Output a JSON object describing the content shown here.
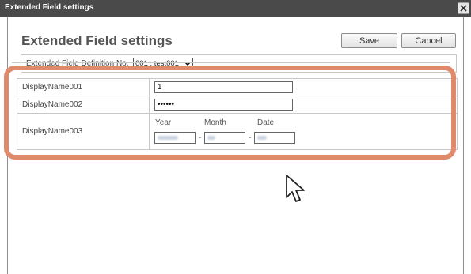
{
  "window": {
    "titlebar_text": "Extended Field settings",
    "page_title": "Extended Field settings"
  },
  "toolbar": {
    "save_label": "Save",
    "cancel_label": "Cancel"
  },
  "definition": {
    "label": "Extended Field Definition No.",
    "selected": "001 : test001"
  },
  "fields": [
    {
      "label": "DisplayName001",
      "value": "1"
    },
    {
      "label": "DisplayName002",
      "value": "••••••"
    },
    {
      "label": "DisplayName003",
      "year_label": "Year",
      "month_label": "Month",
      "date_label": "Date",
      "separator": "-"
    }
  ],
  "icons": {
    "close": "close-icon",
    "dropdown": "chevron-down-icon",
    "cursor": "mouse-pointer-icon"
  },
  "colors": {
    "titlebar": "#4a4a4a",
    "highlight": "#e08a6c",
    "border": "#c8c8c8"
  }
}
